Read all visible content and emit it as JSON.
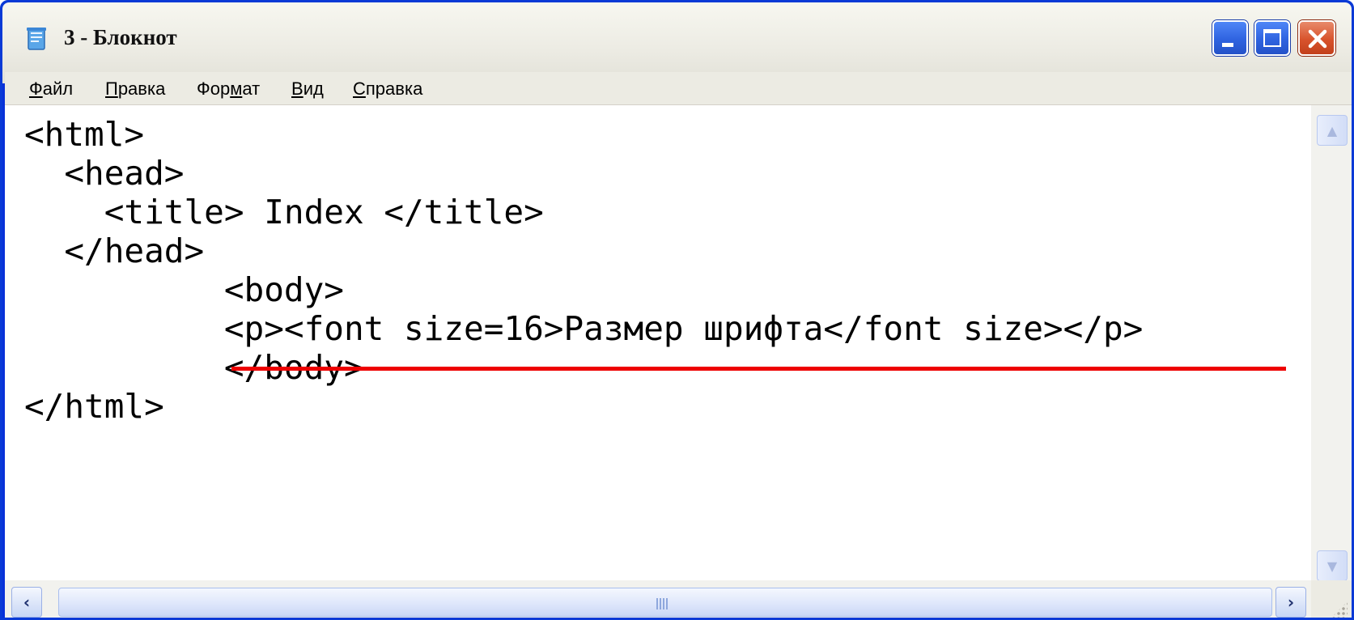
{
  "window": {
    "title": "3 - Блокнот"
  },
  "icons": {
    "app": "notepad-icon",
    "minimize": "minimize-icon",
    "maximize": "maximize-icon",
    "close": "close-icon",
    "scroll_up": "arrow-up-icon",
    "scroll_down": "arrow-down-icon",
    "scroll_left": "arrow-left-icon",
    "scroll_right": "arrow-right-icon"
  },
  "menu": {
    "items": [
      {
        "first": "Ф",
        "rest": "айл"
      },
      {
        "first": "П",
        "rest": "равка"
      },
      {
        "pre": "Фор",
        "ul": "м",
        "post": "ат"
      },
      {
        "first": "В",
        "rest": "ид"
      },
      {
        "first": "С",
        "rest": "правка"
      }
    ]
  },
  "editor": {
    "lines": [
      "<html>",
      "  <head>",
      "    <title> Index </title>",
      "  </head>",
      "          <body>",
      "          <p><font size=16>Размер шрифта</font size></p>",
      "          </body>",
      "</html>"
    ]
  },
  "colors": {
    "titlebar": "#ecebe3",
    "window_frame": "#0831d9",
    "highlight_underline": "#ee0000",
    "close_button": "#d8532c",
    "caption_buttons": "#2f63e0"
  }
}
